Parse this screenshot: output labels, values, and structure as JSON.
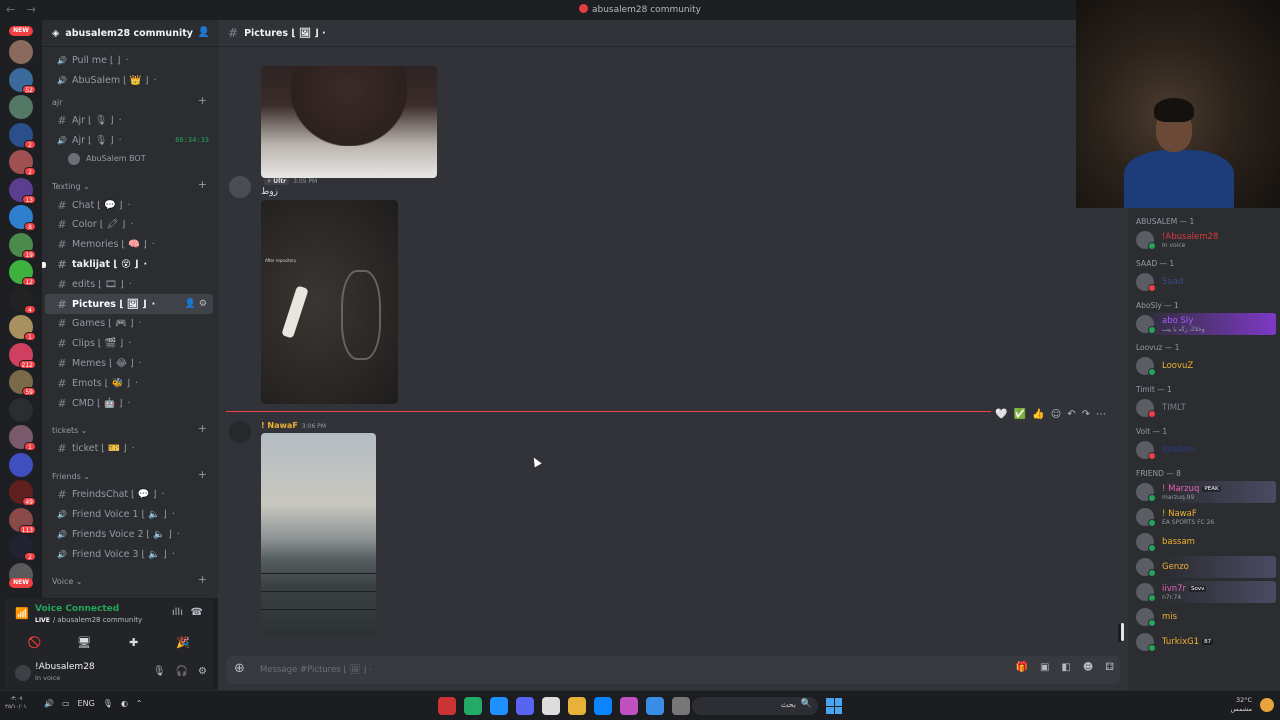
{
  "window": {
    "nav": "← →",
    "title": "abusalem28 community"
  },
  "rail": {
    "new_top": "NEW",
    "new_bottom": "NEW",
    "servers": [
      {
        "badge": "",
        "color": "#8a6a5c"
      },
      {
        "badge": "52",
        "color": "#3a6a9b"
      },
      {
        "badge": "",
        "color": "#557766"
      },
      {
        "badge": "2",
        "color": "#2a4f8a"
      },
      {
        "badge": "2",
        "color": "#a05050"
      },
      {
        "badge": "13",
        "color": "#5b3e8f"
      },
      {
        "badge": "8",
        "color": "#2f7fcf"
      },
      {
        "badge": "19",
        "color": "#4a8a4a"
      },
      {
        "badge": "12",
        "color": "#3fb13f"
      },
      {
        "badge": "4",
        "color": "#222222"
      },
      {
        "badge": "1",
        "color": "#a89060"
      },
      {
        "badge": "212",
        "color": "#cf4060"
      },
      {
        "badge": "59",
        "color": "#7a6a4a"
      },
      {
        "badge": "",
        "color": "#2b2d31"
      },
      {
        "badge": "1",
        "color": "#7a5a6a"
      },
      {
        "badge": "",
        "color": "#3f4fbf"
      },
      {
        "badge": "49",
        "color": "#602020"
      },
      {
        "badge": "113",
        "color": "#8a4a4a"
      },
      {
        "badge": "2",
        "color": "#222233"
      },
      {
        "badge": "",
        "color": "#5a5a5a"
      }
    ]
  },
  "server": {
    "name": "abusalem28 community",
    "chevron": "⌄"
  },
  "channels": {
    "top": [
      {
        "type": "voice",
        "label": "Pull me ⌊ ⌋",
        "extra": "·"
      },
      {
        "type": "voice",
        "label": "AbuSalem ⌊ 👑 ⌋",
        "extra": "·"
      }
    ],
    "cat_ajr": "ajr",
    "ajr": [
      {
        "type": "text",
        "label": "Ajr ⌊ 🎙 ⌋",
        "extra": "·"
      },
      {
        "type": "voice",
        "label": "Ajr ⌊ 🎙 ⌋",
        "extra": "·",
        "timer": "66:34:33"
      }
    ],
    "ajr_user": "AbuSalem BOT",
    "cat_texting": "Texting ⌄",
    "texting": [
      {
        "label": "Chat ⌊ 💬 ⌋",
        "extra": "·"
      },
      {
        "label": "Color ⌊ 🖍 ⌋",
        "extra": "·"
      },
      {
        "label": "Memories ⌊ 🧠 ⌋",
        "extra": "·"
      },
      {
        "label": "taklijat ⌊ 😵 ⌋",
        "extra": "·",
        "bold": true
      },
      {
        "label": "edits ⌊ 🎞 ⌋",
        "extra": "·"
      },
      {
        "label": "Pictures ⌊ 🖼 ⌋",
        "extra": "·",
        "active": true,
        "icons": "👤 ⚙"
      },
      {
        "label": "Games ⌊ 🎮 ⌋",
        "extra": "·"
      },
      {
        "label": "Clips ⌊ 🎬 ⌋",
        "extra": "·"
      },
      {
        "label": "Memes ⌊ 😂 ⌋",
        "extra": "·"
      },
      {
        "label": "Emots ⌊ 🐝 ⌋",
        "extra": "·"
      },
      {
        "label": "CMD ⌊ 🤖 ⌋",
        "extra": "·"
      }
    ],
    "cat_tickets": "tickets ⌄",
    "tickets": [
      {
        "label": "ticket ⌊ 🎫 ⌋",
        "extra": "·"
      }
    ],
    "cat_friends": "Friends ⌄",
    "friends": [
      {
        "type": "text",
        "label": "FreindsChat ⌊ 💬 ⌋",
        "extra": "·"
      },
      {
        "type": "voice",
        "label": "Friend Voice 1 ⌊ 🔈 ⌋",
        "extra": "·"
      },
      {
        "type": "voice",
        "label": "Friends Voice 2 ⌊ 🔈 ⌋",
        "extra": "·"
      },
      {
        "type": "voice",
        "label": "Friend Voice 3 ⌊ 🔈 ⌋",
        "extra": "·"
      }
    ],
    "cat_voice": "Voice ⌄"
  },
  "voice_panel": {
    "status": "Voice Connected",
    "live": "LIVE",
    "where": "/ abusalem28 community"
  },
  "user_panel": {
    "name": "!Abusalem28",
    "status": "In voice"
  },
  "chat": {
    "channel": "Pictures ⌊ 🖼 ⌋ ·",
    "messages": [
      {
        "author": "",
        "time": "3:05 PM",
        "tag": "⚡ Ultr",
        "text": "زوط",
        "name_color": "#d83c3e"
      },
      {
        "author": "! NawaF",
        "time": "3:06 PM",
        "name_color": "#f0b232"
      }
    ],
    "image_caption": "After repository",
    "composer_placeholder": "Message #Pictures ⌊ 🖼 ⌋ ·"
  },
  "members": {
    "groups": [
      {
        "title": "ABUSALEM — 1",
        "members": [
          {
            "name": "!Abusalem28",
            "sub": "In voice",
            "color": "#d83c3e",
            "status": "online"
          }
        ]
      },
      {
        "title": "SAAD — 1",
        "members": [
          {
            "name": "Saad",
            "sub": "",
            "color": "#3f4a8a",
            "status": "dnd"
          }
        ]
      },
      {
        "title": "AboSly — 1",
        "members": [
          {
            "name": "abo Sly",
            "sub": "وخلاڭ زڭه يا بيب",
            "color": "#a35cff",
            "status": "online",
            "boost": true
          }
        ]
      },
      {
        "title": "Loovuz — 1",
        "members": [
          {
            "name": "LoovuZ",
            "sub": "",
            "color": "#f0b232",
            "status": "none"
          }
        ]
      },
      {
        "title": "Timlt — 1",
        "members": [
          {
            "name": "TIMLT",
            "sub": "",
            "color": "#7a7f87",
            "status": "dnd"
          }
        ]
      },
      {
        "title": "Volt — 1",
        "members": [
          {
            "name": "Ibrahim",
            "sub": "",
            "color": "#2a3a8a",
            "status": "dnd"
          }
        ]
      },
      {
        "title": "FRIEND — 8",
        "members": [
          {
            "name": "! Marzuq",
            "sub": "marzuq.99",
            "color": "#e65fbb",
            "status": "online",
            "tag": "PEAK",
            "boost2": true
          },
          {
            "name": "! NawaF",
            "sub": "EA SPORTS FC 26",
            "color": "#f0b232",
            "status": "online"
          },
          {
            "name": "bassam",
            "sub": "",
            "color": "#f0b232",
            "status": "online"
          },
          {
            "name": "Genzo",
            "sub": "",
            "color": "#f0b232",
            "status": "online",
            "boost2": true
          },
          {
            "name": "iivn7r",
            "sub": "n7r.74",
            "color": "#e65fbb",
            "status": "online",
            "tag": "Sovv",
            "boost2": true
          },
          {
            "name": "mis",
            "sub": "",
            "color": "#f0b232",
            "status": "online"
          },
          {
            "name": "TurkixG1",
            "sub": "",
            "color": "#f0b232",
            "status": "online",
            "tag": "87"
          }
        ]
      }
    ]
  },
  "taskbar": {
    "time": "٠٣:٠٧",
    "date": "٢٥/١٠/٠١",
    "lang": "ENG",
    "search_text": "بحث",
    "temp": "32°C",
    "weather": "مشمس",
    "apps": [
      "#c33",
      "#2a6",
      "#1e90ff",
      "#5865f2",
      "#ddd",
      "#e8b23a",
      "#0a84ff",
      "#c050c0",
      "#3a8ee6",
      "#777"
    ]
  },
  "colors": {
    "accent": "#5865f2",
    "online": "#23a55a",
    "dnd": "#f23f43",
    "unread": "#f23f43"
  }
}
